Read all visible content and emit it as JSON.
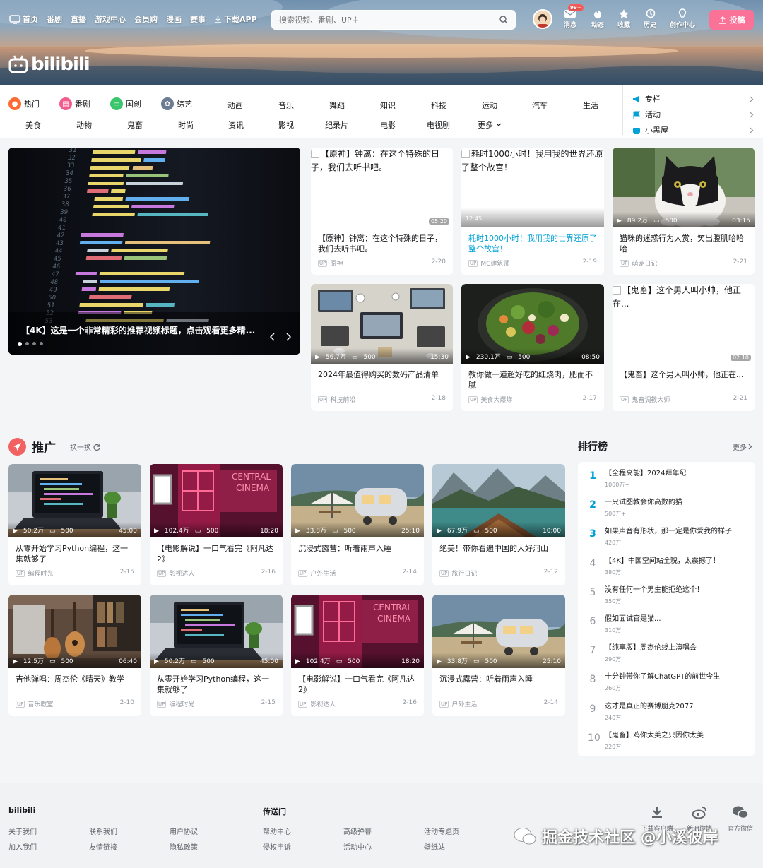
{
  "header": {
    "nav": [
      "首页",
      "番剧",
      "直播",
      "游戏中心",
      "会员购",
      "漫画",
      "赛事",
      "下载APP"
    ],
    "search_placeholder": "搜索视频、番剧、UP主",
    "right_nav": [
      {
        "label": "消息",
        "icon": "mail-icon",
        "badge": "99+"
      },
      {
        "label": "动态",
        "icon": "flame-icon"
      },
      {
        "label": "收藏",
        "icon": "star-icon"
      },
      {
        "label": "历史",
        "icon": "history-icon"
      },
      {
        "label": "创作中心",
        "icon": "bulb-icon"
      }
    ],
    "upload_label": "投稿",
    "logo_text": "bilibili"
  },
  "channels": {
    "row1": [
      "热门",
      "番剧",
      "国创",
      "综艺",
      "动画",
      "音乐",
      "舞蹈",
      "知识",
      "科技",
      "运动",
      "汽车",
      "生活"
    ],
    "row2": [
      "美食",
      "动物",
      "鬼畜",
      "时尚",
      "资讯",
      "影视",
      "纪录片",
      "电影",
      "电视剧",
      "更多"
    ],
    "side": [
      "专栏",
      "活动",
      "小黑屋"
    ]
  },
  "carousel": {
    "title": "【4K】这是一个非常精彩的推荐视频标题，点击观看更多精..."
  },
  "feed": [
    {
      "title": "【原神】钟离：在这个特殊的日子，我们去听书吧。",
      "alt": "【原神】钟离：在这个特殊的日子，我们去听书吧。",
      "up": "原神",
      "date": "2-20",
      "duration": "05:20",
      "views": "",
      "danmaku": ""
    },
    {
      "title": "耗时1000小时！我用我的世界还原了整个故宫！",
      "alt": "耗时1000小时！我用我的世界还原了整个故宫！",
      "up": "MC建筑师",
      "date": "2-19",
      "duration": "12:45",
      "views": "",
      "danmaku": ""
    },
    {
      "title": "猫咪的迷惑行为大赏，笑出腹肌哈哈哈",
      "up": "萌宠日记",
      "date": "2-21",
      "duration": "03:15",
      "views": "89.2万",
      "danmaku": "500"
    },
    {
      "title": "2024年最值得购买的数码产品清单",
      "up": "科技前沿",
      "date": "2-18",
      "duration": "15:30",
      "views": "56.7万",
      "danmaku": "500"
    },
    {
      "title": "教你做一道超好吃的红烧肉，肥而不腻",
      "up": "美食大爆炸",
      "date": "2-17",
      "duration": "08:50",
      "views": "230.1万",
      "danmaku": "500"
    },
    {
      "title": "【鬼畜】这个男人叫小帅，他正在...",
      "alt": "【鬼畜】这个男人叫小帅，他正在...",
      "up": "鬼畜调教大师",
      "date": "2-21",
      "duration": "02:10",
      "views": "",
      "danmaku": ""
    }
  ],
  "promo": {
    "title": "推广",
    "refresh": "换一换",
    "items": [
      {
        "title": "从零开始学习Python编程，这一集就够了",
        "up": "编程时光",
        "date": "2-15",
        "duration": "45:00",
        "views": "50.2万",
        "danmaku": "500",
        "img": "code"
      },
      {
        "title": "【电影解说】一口气看完《阿凡达2》",
        "up": "影视达人",
        "date": "2-16",
        "duration": "18:20",
        "views": "102.4万",
        "danmaku": "500",
        "img": "cinema"
      },
      {
        "title": "沉浸式露营：听着雨声入睡",
        "up": "户外生活",
        "date": "2-14",
        "duration": "25:10",
        "views": "33.8万",
        "danmaku": "500",
        "img": "camp"
      },
      {
        "title": "绝美！带你看遍中国的大好河山",
        "up": "旅行日记",
        "date": "2-12",
        "duration": "10:00",
        "views": "67.9万",
        "danmaku": "500",
        "img": "lake"
      },
      {
        "title": "吉他弹唱：周杰伦《晴天》教学",
        "up": "音乐教室",
        "date": "2-10",
        "duration": "06:40",
        "views": "12.5万",
        "danmaku": "500",
        "img": "guitar"
      },
      {
        "title": "从零开始学习Python编程，这一集就够了",
        "up": "编程时光",
        "date": "2-15",
        "duration": "45:00",
        "views": "50.2万",
        "danmaku": "500",
        "img": "code"
      },
      {
        "title": "【电影解说】一口气看完《阿凡达2》",
        "up": "影视达人",
        "date": "2-16",
        "duration": "18:20",
        "views": "102.4万",
        "danmaku": "500",
        "img": "cinema"
      },
      {
        "title": "沉浸式露营：听着雨声入睡",
        "up": "户外生活",
        "date": "2-14",
        "duration": "25:10",
        "views": "33.8万",
        "danmaku": "500",
        "img": "camp"
      }
    ]
  },
  "ranking": {
    "title": "排行榜",
    "more": "更多",
    "items": [
      {
        "n": "1",
        "t": "【全程高能】2024拜年纪",
        "v": "1000万+"
      },
      {
        "n": "2",
        "t": "一只试图教会你高数的猫",
        "v": "500万+"
      },
      {
        "n": "3",
        "t": "如果声音有形状，那一定是你爱我的样子",
        "v": "420万"
      },
      {
        "n": "4",
        "t": "【4K】中国空间站全貌，太震撼了！",
        "v": "380万"
      },
      {
        "n": "5",
        "t": "没有任何一个男生能拒绝这个！",
        "v": "350万"
      },
      {
        "n": "6",
        "t": "假如面试官是猫...",
        "v": "310万"
      },
      {
        "n": "7",
        "t": "【纯享版】周杰伦线上演唱会",
        "v": "290万"
      },
      {
        "n": "8",
        "t": "十分钟带你了解ChatGPT的前世今生",
        "v": "260万"
      },
      {
        "n": "9",
        "t": "这才是真正的赛博朋克2077",
        "v": "240万"
      },
      {
        "n": "10",
        "t": "【鬼畜】鸡你太美之只因你太美",
        "v": "220万"
      }
    ]
  },
  "footer": {
    "col1_title": "bilibili",
    "col1": [
      "关于我们",
      "联系我们",
      "用户协议",
      "加入我们",
      "友情链接",
      "隐私政策"
    ],
    "col2_title": "传送门",
    "col2": [
      "帮助中心",
      "高级弹幕",
      "活动专题页",
      "侵权申诉",
      "活动中心",
      "壁纸站"
    ],
    "icons": [
      {
        "label": "下载客户端",
        "icon": "download-icon"
      },
      {
        "label": "新浪微博",
        "icon": "weibo-icon"
      },
      {
        "label": "官方微信",
        "icon": "wechat-icon"
      }
    ],
    "watermark": "掘金技术社区 @小溪彼岸"
  },
  "colors": {
    "accent": "#fb7299",
    "blue": "#00a1d6"
  }
}
